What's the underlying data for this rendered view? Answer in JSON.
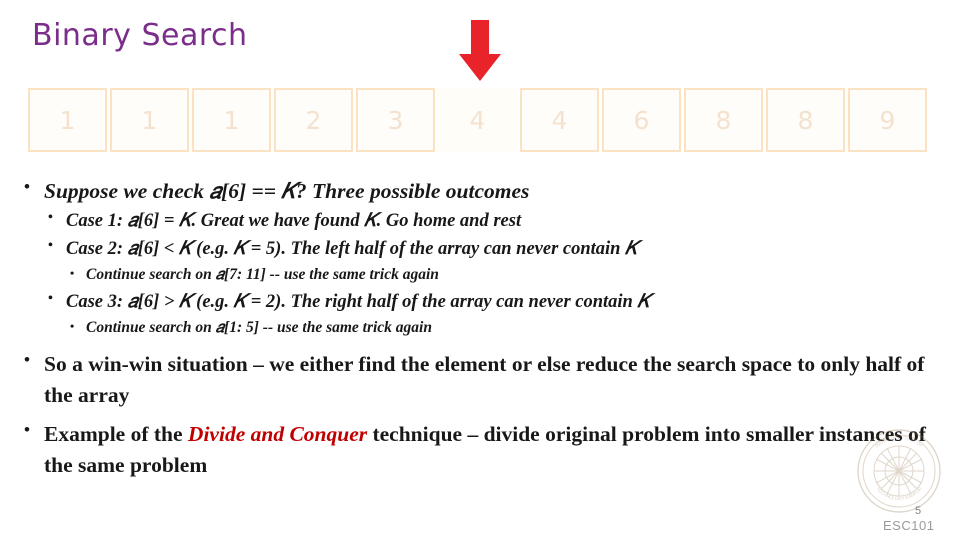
{
  "slide": {
    "title": "Binary Search",
    "number": "5",
    "course_code": "ESC101",
    "arrow_color": "#e8232a",
    "title_color": "#7b2d8b",
    "accent_color": "#c00000"
  },
  "array": {
    "cells": [
      "1",
      "1",
      "1",
      "2",
      "3",
      "4",
      "4",
      "6",
      "8",
      "8",
      "9"
    ],
    "highlight_index": 5
  },
  "body": {
    "b1": "Suppose we check 𝑎[6] == 𝐾? Three possible outcomes",
    "b1_1": "Case 1: 𝑎[6] = 𝐾. Great we have found 𝐾. Go home and rest",
    "b1_2": "Case 2: 𝑎[6] < 𝐾 (e.g. 𝐾 = 5). The left half of the array can never contain 𝐾",
    "b1_2_1": "Continue search on 𝑎[7: 11] -- use the same trick again",
    "b1_3": "Case 3: 𝑎[6] > 𝐾 (e.g. 𝐾 = 2). The right half of the array can never contain 𝐾",
    "b1_3_1": "Continue search on 𝑎[1: 5] -- use the same trick again",
    "b2": "So a win-win situation – we either find the element or else reduce the search space to only half of the array",
    "b3_pre": "Example of the ",
    "b3_emph": "Divide and Conquer",
    "b3_post": " technique – divide original problem into smaller instances of the same problem"
  },
  "icons": {
    "bullet": "•",
    "down_arrow": "down-arrow-icon",
    "logo": "institute-seal-icon"
  },
  "logo": {
    "outer_text": "INDIAN INSTITUTE OF TECHNOLOGY KANPUR"
  }
}
